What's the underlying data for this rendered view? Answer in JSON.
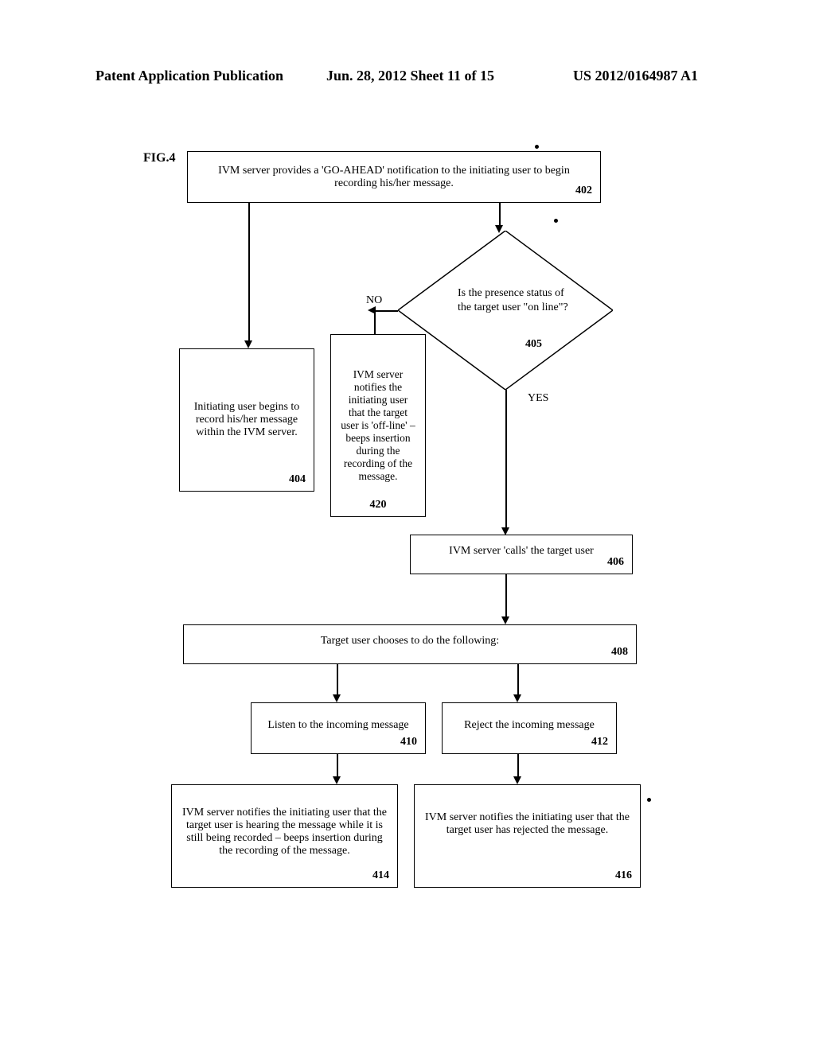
{
  "header": {
    "left": "Patent Application Publication",
    "center": "Jun. 28, 2012  Sheet 11 of 15",
    "right": "US 2012/0164987 A1"
  },
  "figLabel": "FIG.4",
  "boxes": {
    "b402": {
      "text": "IVM server provides a 'GO-AHEAD' notification to the initiating user to begin recording his/her message.",
      "num": "402"
    },
    "b404": {
      "text": "Initiating user begins to record his/her message within the IVM server.",
      "num": "404"
    },
    "b420": {
      "text": "IVM server notifies the initiating user that the target user is 'off-line' – beeps insertion during the recording of the message.",
      "num": "420"
    },
    "b406": {
      "text": "IVM server 'calls' the target user",
      "num": "406"
    },
    "b408": {
      "text": "Target user chooses to do the following:",
      "num": "408"
    },
    "b410": {
      "text": "Listen to the incoming message",
      "num": "410"
    },
    "b412": {
      "text": "Reject the incoming message",
      "num": "412"
    },
    "b414": {
      "text": "IVM server notifies the initiating user that the target user is hearing the message while it is still being recorded – beeps insertion during the recording of the message.",
      "num": "414"
    },
    "b416": {
      "text": "IVM server notifies the initiating user that the target user has rejected the message.",
      "num": "416"
    }
  },
  "diamond": {
    "text": "Is the presence status of the target user \"on line\"?",
    "num": "405"
  },
  "labels": {
    "no": "NO",
    "yes": "YES"
  },
  "chart_data": {
    "type": "flowchart",
    "nodes": [
      {
        "id": "402",
        "type": "process",
        "text": "IVM server provides a 'GO-AHEAD' notification to the initiating user to begin recording his/her message."
      },
      {
        "id": "404",
        "type": "process",
        "text": "Initiating user begins to record his/her message within the IVM server."
      },
      {
        "id": "405",
        "type": "decision",
        "text": "Is the presence status of the target user \"on line\"?"
      },
      {
        "id": "420",
        "type": "process",
        "text": "IVM server notifies the initiating user that the target user is 'off-line' – beeps insertion during the recording of the message."
      },
      {
        "id": "406",
        "type": "process",
        "text": "IVM server 'calls' the target user"
      },
      {
        "id": "408",
        "type": "process",
        "text": "Target user chooses to do the following:"
      },
      {
        "id": "410",
        "type": "process",
        "text": "Listen to the incoming message"
      },
      {
        "id": "412",
        "type": "process",
        "text": "Reject the incoming message"
      },
      {
        "id": "414",
        "type": "process",
        "text": "IVM server notifies the initiating user that the target user is hearing the message while it is still being recorded – beeps insertion during the recording of the message."
      },
      {
        "id": "416",
        "type": "process",
        "text": "IVM server notifies the initiating user that the target user has rejected the message."
      }
    ],
    "edges": [
      {
        "from": "402",
        "to": "404"
      },
      {
        "from": "402",
        "to": "405"
      },
      {
        "from": "405",
        "to": "420",
        "label": "NO"
      },
      {
        "from": "405",
        "to": "406",
        "label": "YES"
      },
      {
        "from": "406",
        "to": "408"
      },
      {
        "from": "408",
        "to": "410"
      },
      {
        "from": "408",
        "to": "412"
      },
      {
        "from": "410",
        "to": "414"
      },
      {
        "from": "412",
        "to": "416"
      }
    ]
  }
}
